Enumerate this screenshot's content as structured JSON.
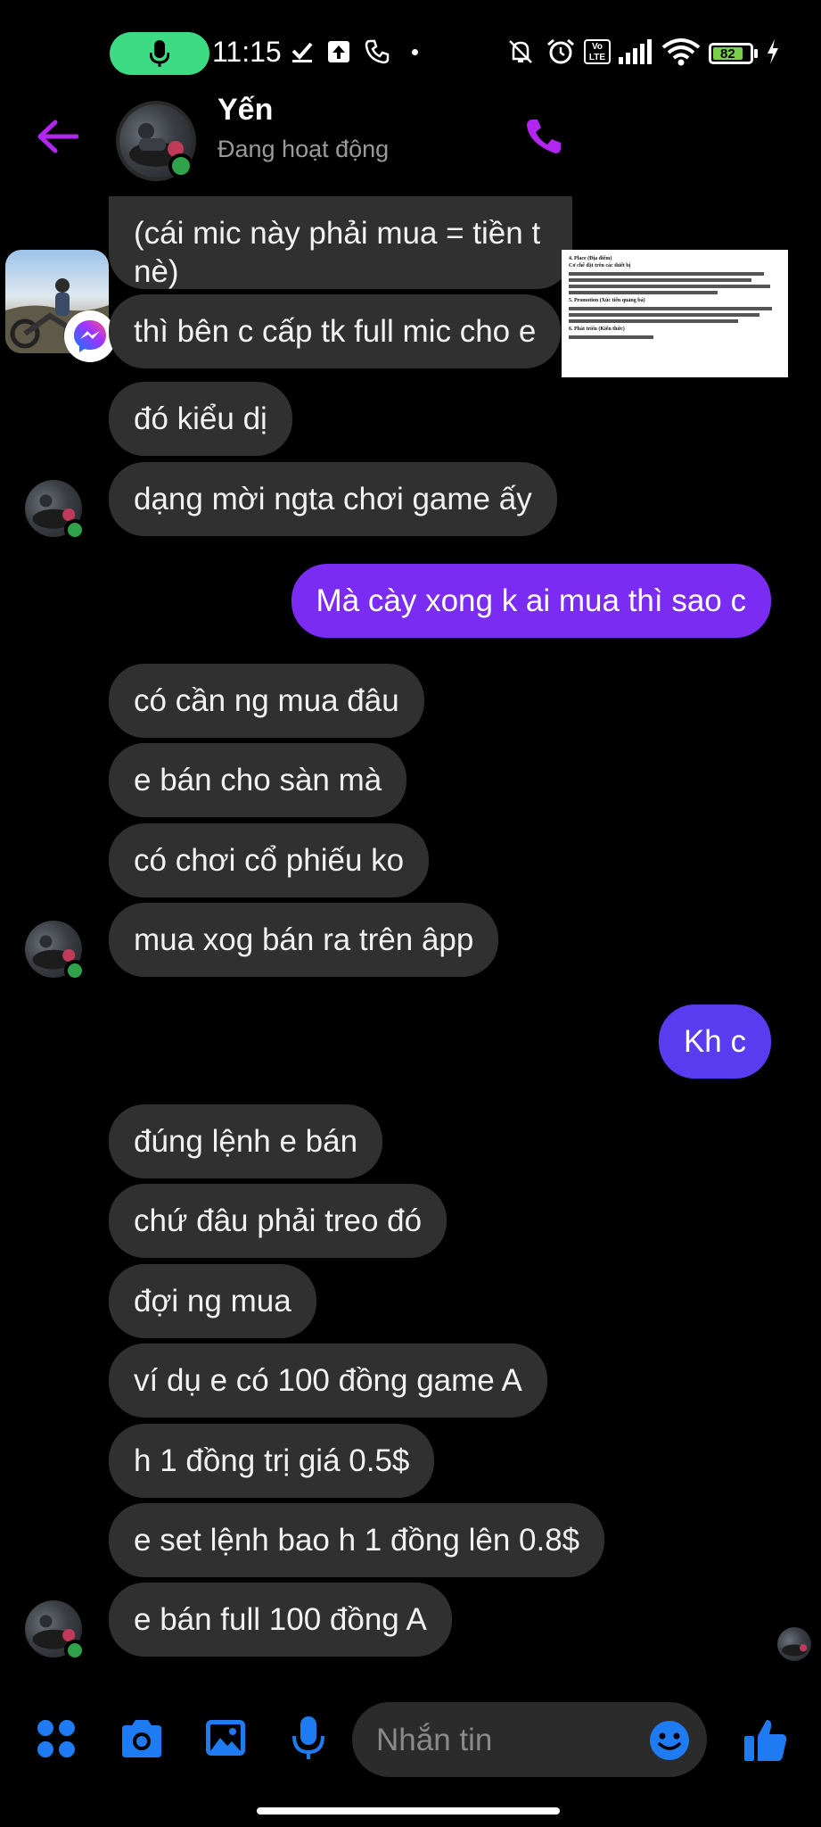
{
  "status_bar": {
    "time": "11:15",
    "battery": "82",
    "network": "Vo LTE",
    "icons": [
      "mic-icon",
      "download-icon",
      "upload-icon",
      "call-icon",
      "dot-icon",
      "mute-icon",
      "alarm-icon",
      "signal-icon",
      "wifi-icon",
      "battery-icon",
      "charging-icon"
    ]
  },
  "header": {
    "name": "Yến",
    "status": "Đang hoạt động"
  },
  "messages": [
    {
      "from": "them",
      "text": "(cái mic này phải mua = tiền t"
    },
    {
      "from": "them",
      "text": "nè)"
    },
    {
      "from": "them",
      "text": "thì bên c cấp tk full mic cho e"
    },
    {
      "from": "them",
      "text": "đó kiểu dị"
    },
    {
      "from": "them",
      "text": "dạng mời ngta chơi game ấy"
    },
    {
      "from": "me",
      "text": "Mà cày xong k ai mua thì sao c"
    },
    {
      "from": "them",
      "text": "có cần ng mua đâu"
    },
    {
      "from": "them",
      "text": "e bán cho sàn mà"
    },
    {
      "from": "them",
      "text": "có chơi cổ phiếu ko"
    },
    {
      "from": "them",
      "text": "mua xog bán ra trên âpp"
    },
    {
      "from": "me",
      "text": "Kh c"
    },
    {
      "from": "them",
      "text": "đúng lệnh e bán"
    },
    {
      "from": "them",
      "text": "chứ đâu phải treo đó"
    },
    {
      "from": "them",
      "text": "đợi ng mua"
    },
    {
      "from": "them",
      "text": "ví dụ e có 100 đồng game A"
    },
    {
      "from": "them",
      "text": "h 1 đồng trị giá 0.5$"
    },
    {
      "from": "them",
      "text": "e set lệnh bao h 1 đồng lên 0.8$"
    },
    {
      "from": "them",
      "text": "e bán full 100 đồng A"
    }
  ],
  "shared_document": {
    "heading": "4. Place (Địa điểm)",
    "lines": [
      "Cơ chế đặt trên các thiết bị",
      "5. Promotion (Xúc tiến quảng bá)",
      "6. Phát triển (Kiến thức)"
    ]
  },
  "composer": {
    "placeholder": "Nhắn tin"
  },
  "colors": {
    "accent": "#a020f0",
    "my_bubble": "#7b2cf2",
    "their_bubble": "#303030",
    "icon_blue": "#1f7bf2"
  }
}
